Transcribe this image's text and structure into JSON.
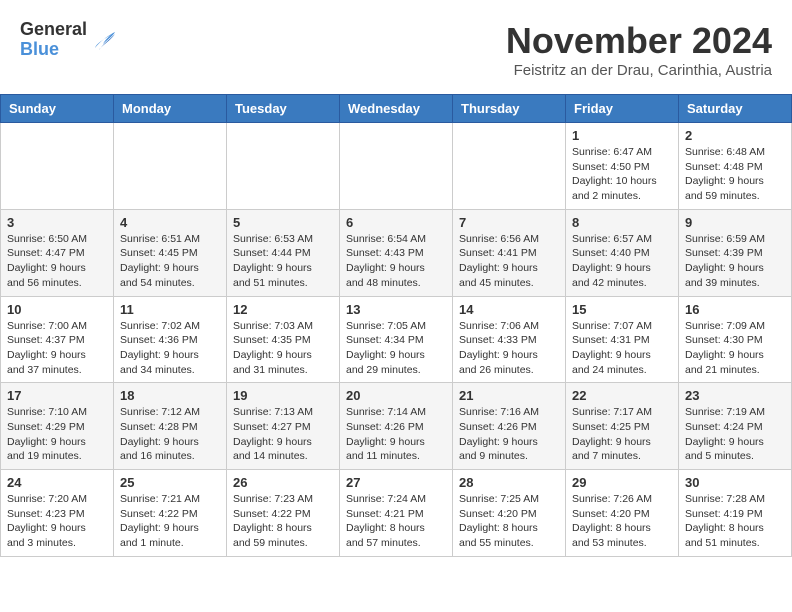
{
  "header": {
    "logo": {
      "general": "General",
      "blue": "Blue"
    },
    "title": "November 2024",
    "location": "Feistritz an der Drau, Carinthia, Austria"
  },
  "calendar": {
    "weekdays": [
      "Sunday",
      "Monday",
      "Tuesday",
      "Wednesday",
      "Thursday",
      "Friday",
      "Saturday"
    ],
    "weeks": [
      {
        "days": [
          {
            "number": "",
            "info": ""
          },
          {
            "number": "",
            "info": ""
          },
          {
            "number": "",
            "info": ""
          },
          {
            "number": "",
            "info": ""
          },
          {
            "number": "",
            "info": ""
          },
          {
            "number": "1",
            "info": "Sunrise: 6:47 AM\nSunset: 4:50 PM\nDaylight: 10 hours\nand 2 minutes."
          },
          {
            "number": "2",
            "info": "Sunrise: 6:48 AM\nSunset: 4:48 PM\nDaylight: 9 hours\nand 59 minutes."
          }
        ]
      },
      {
        "days": [
          {
            "number": "3",
            "info": "Sunrise: 6:50 AM\nSunset: 4:47 PM\nDaylight: 9 hours\nand 56 minutes."
          },
          {
            "number": "4",
            "info": "Sunrise: 6:51 AM\nSunset: 4:45 PM\nDaylight: 9 hours\nand 54 minutes."
          },
          {
            "number": "5",
            "info": "Sunrise: 6:53 AM\nSunset: 4:44 PM\nDaylight: 9 hours\nand 51 minutes."
          },
          {
            "number": "6",
            "info": "Sunrise: 6:54 AM\nSunset: 4:43 PM\nDaylight: 9 hours\nand 48 minutes."
          },
          {
            "number": "7",
            "info": "Sunrise: 6:56 AM\nSunset: 4:41 PM\nDaylight: 9 hours\nand 45 minutes."
          },
          {
            "number": "8",
            "info": "Sunrise: 6:57 AM\nSunset: 4:40 PM\nDaylight: 9 hours\nand 42 minutes."
          },
          {
            "number": "9",
            "info": "Sunrise: 6:59 AM\nSunset: 4:39 PM\nDaylight: 9 hours\nand 39 minutes."
          }
        ]
      },
      {
        "days": [
          {
            "number": "10",
            "info": "Sunrise: 7:00 AM\nSunset: 4:37 PM\nDaylight: 9 hours\nand 37 minutes."
          },
          {
            "number": "11",
            "info": "Sunrise: 7:02 AM\nSunset: 4:36 PM\nDaylight: 9 hours\nand 34 minutes."
          },
          {
            "number": "12",
            "info": "Sunrise: 7:03 AM\nSunset: 4:35 PM\nDaylight: 9 hours\nand 31 minutes."
          },
          {
            "number": "13",
            "info": "Sunrise: 7:05 AM\nSunset: 4:34 PM\nDaylight: 9 hours\nand 29 minutes."
          },
          {
            "number": "14",
            "info": "Sunrise: 7:06 AM\nSunset: 4:33 PM\nDaylight: 9 hours\nand 26 minutes."
          },
          {
            "number": "15",
            "info": "Sunrise: 7:07 AM\nSunset: 4:31 PM\nDaylight: 9 hours\nand 24 minutes."
          },
          {
            "number": "16",
            "info": "Sunrise: 7:09 AM\nSunset: 4:30 PM\nDaylight: 9 hours\nand 21 minutes."
          }
        ]
      },
      {
        "days": [
          {
            "number": "17",
            "info": "Sunrise: 7:10 AM\nSunset: 4:29 PM\nDaylight: 9 hours\nand 19 minutes."
          },
          {
            "number": "18",
            "info": "Sunrise: 7:12 AM\nSunset: 4:28 PM\nDaylight: 9 hours\nand 16 minutes."
          },
          {
            "number": "19",
            "info": "Sunrise: 7:13 AM\nSunset: 4:27 PM\nDaylight: 9 hours\nand 14 minutes."
          },
          {
            "number": "20",
            "info": "Sunrise: 7:14 AM\nSunset: 4:26 PM\nDaylight: 9 hours\nand 11 minutes."
          },
          {
            "number": "21",
            "info": "Sunrise: 7:16 AM\nSunset: 4:26 PM\nDaylight: 9 hours\nand 9 minutes."
          },
          {
            "number": "22",
            "info": "Sunrise: 7:17 AM\nSunset: 4:25 PM\nDaylight: 9 hours\nand 7 minutes."
          },
          {
            "number": "23",
            "info": "Sunrise: 7:19 AM\nSunset: 4:24 PM\nDaylight: 9 hours\nand 5 minutes."
          }
        ]
      },
      {
        "days": [
          {
            "number": "24",
            "info": "Sunrise: 7:20 AM\nSunset: 4:23 PM\nDaylight: 9 hours\nand 3 minutes."
          },
          {
            "number": "25",
            "info": "Sunrise: 7:21 AM\nSunset: 4:22 PM\nDaylight: 9 hours\nand 1 minute."
          },
          {
            "number": "26",
            "info": "Sunrise: 7:23 AM\nSunset: 4:22 PM\nDaylight: 8 hours\nand 59 minutes."
          },
          {
            "number": "27",
            "info": "Sunrise: 7:24 AM\nSunset: 4:21 PM\nDaylight: 8 hours\nand 57 minutes."
          },
          {
            "number": "28",
            "info": "Sunrise: 7:25 AM\nSunset: 4:20 PM\nDaylight: 8 hours\nand 55 minutes."
          },
          {
            "number": "29",
            "info": "Sunrise: 7:26 AM\nSunset: 4:20 PM\nDaylight: 8 hours\nand 53 minutes."
          },
          {
            "number": "30",
            "info": "Sunrise: 7:28 AM\nSunset: 4:19 PM\nDaylight: 8 hours\nand 51 minutes."
          }
        ]
      }
    ]
  }
}
